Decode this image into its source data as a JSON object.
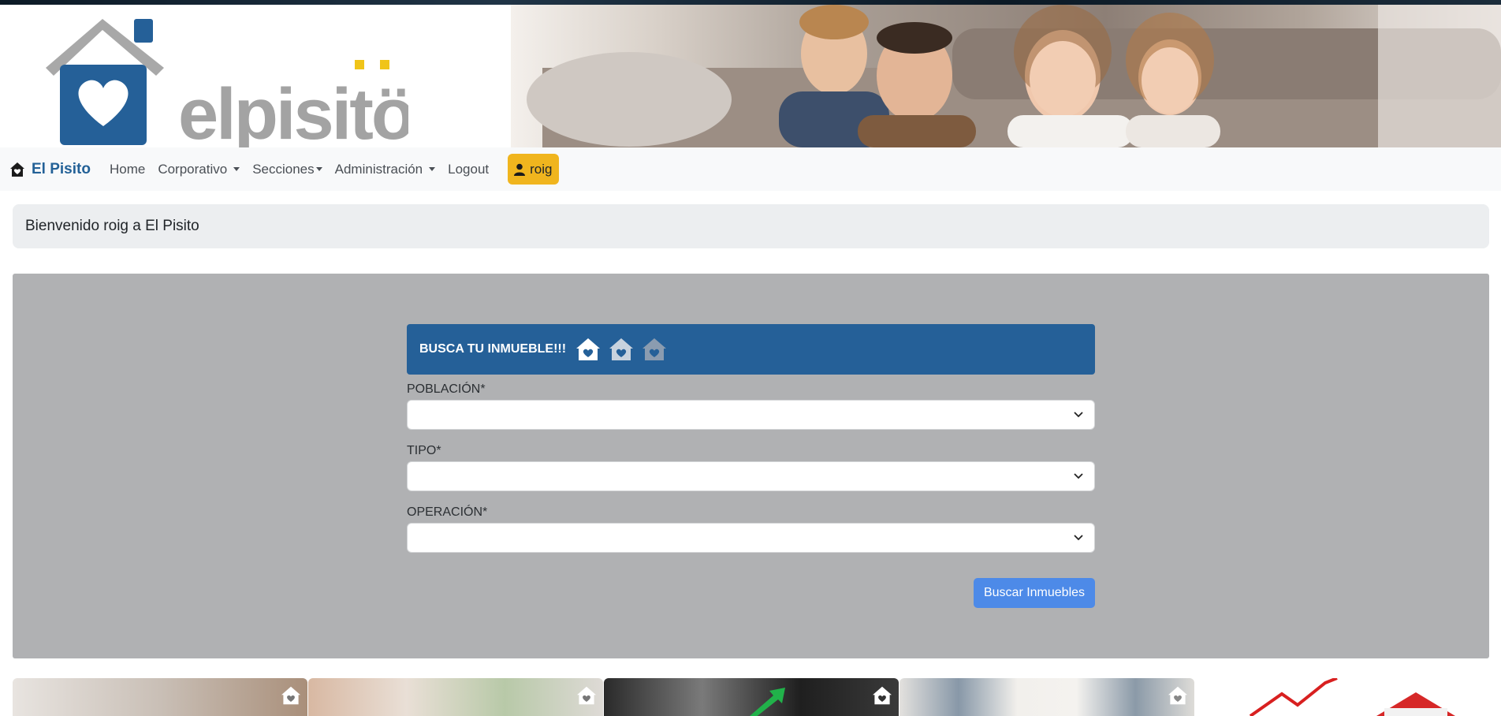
{
  "header": {
    "logo_text": "elpisito",
    "photo_alt": "family-photo"
  },
  "navbar": {
    "brand": "El Pisito",
    "items": [
      {
        "label": "Home",
        "dropdown": false
      },
      {
        "label": "Corporativo",
        "dropdown": true
      },
      {
        "label": "Secciones",
        "dropdown": true
      },
      {
        "label": "Administración",
        "dropdown": true
      },
      {
        "label": "Logout",
        "dropdown": false
      }
    ],
    "user": "roig"
  },
  "welcome": "Bienvenido roig a El Pisito",
  "search": {
    "title": "BUSCA TU INMUEBLE!!!",
    "fields": [
      {
        "label": "POBLACIÓN*",
        "value": ""
      },
      {
        "label": "TIPO*",
        "value": ""
      },
      {
        "label": "OPERACIÓN*",
        "value": ""
      }
    ],
    "button": "Buscar Inmuebles"
  },
  "colors": {
    "brand_blue": "#256098",
    "user_badge": "#f0b51e",
    "search_button": "#4d8ae8",
    "panel_bg": "#b0b1b3"
  },
  "tiles": [
    {
      "icon": "house-heart-icon"
    },
    {
      "icon": "house-heart-icon"
    },
    {
      "icon": "house-heart-icon"
    },
    {
      "icon": "house-heart-icon"
    },
    {
      "icon": "none"
    }
  ]
}
